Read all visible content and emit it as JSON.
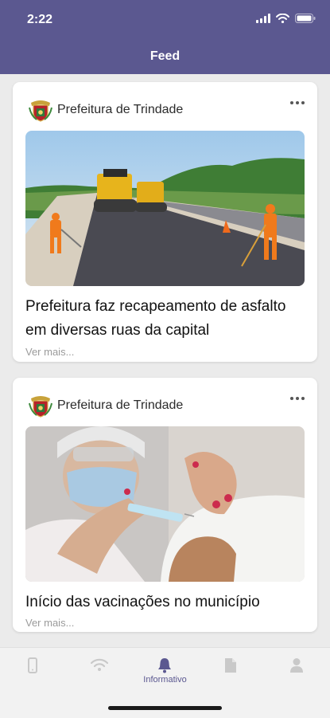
{
  "status": {
    "time": "2:22"
  },
  "header": {
    "title": "Feed"
  },
  "posts": [
    {
      "author": "Prefeitura de Trindade",
      "title": "Prefeitura faz recapeamento de asfalto em diversas ruas da capital",
      "read_more": "Ver mais..."
    },
    {
      "author": "Prefeitura de Trindade",
      "title": "Início das vacinações no município",
      "read_more": "Ver mais..."
    }
  ],
  "tabbar": {
    "items": [
      {
        "icon": "phone-icon",
        "label": ""
      },
      {
        "icon": "wifi-icon",
        "label": ""
      },
      {
        "icon": "bell-icon",
        "label": "Informativo"
      },
      {
        "icon": "document-icon",
        "label": ""
      },
      {
        "icon": "person-icon",
        "label": ""
      }
    ],
    "active_index": 2
  },
  "colors": {
    "brand": "#5b5890",
    "inactive_icon": "#c9c9c9"
  }
}
